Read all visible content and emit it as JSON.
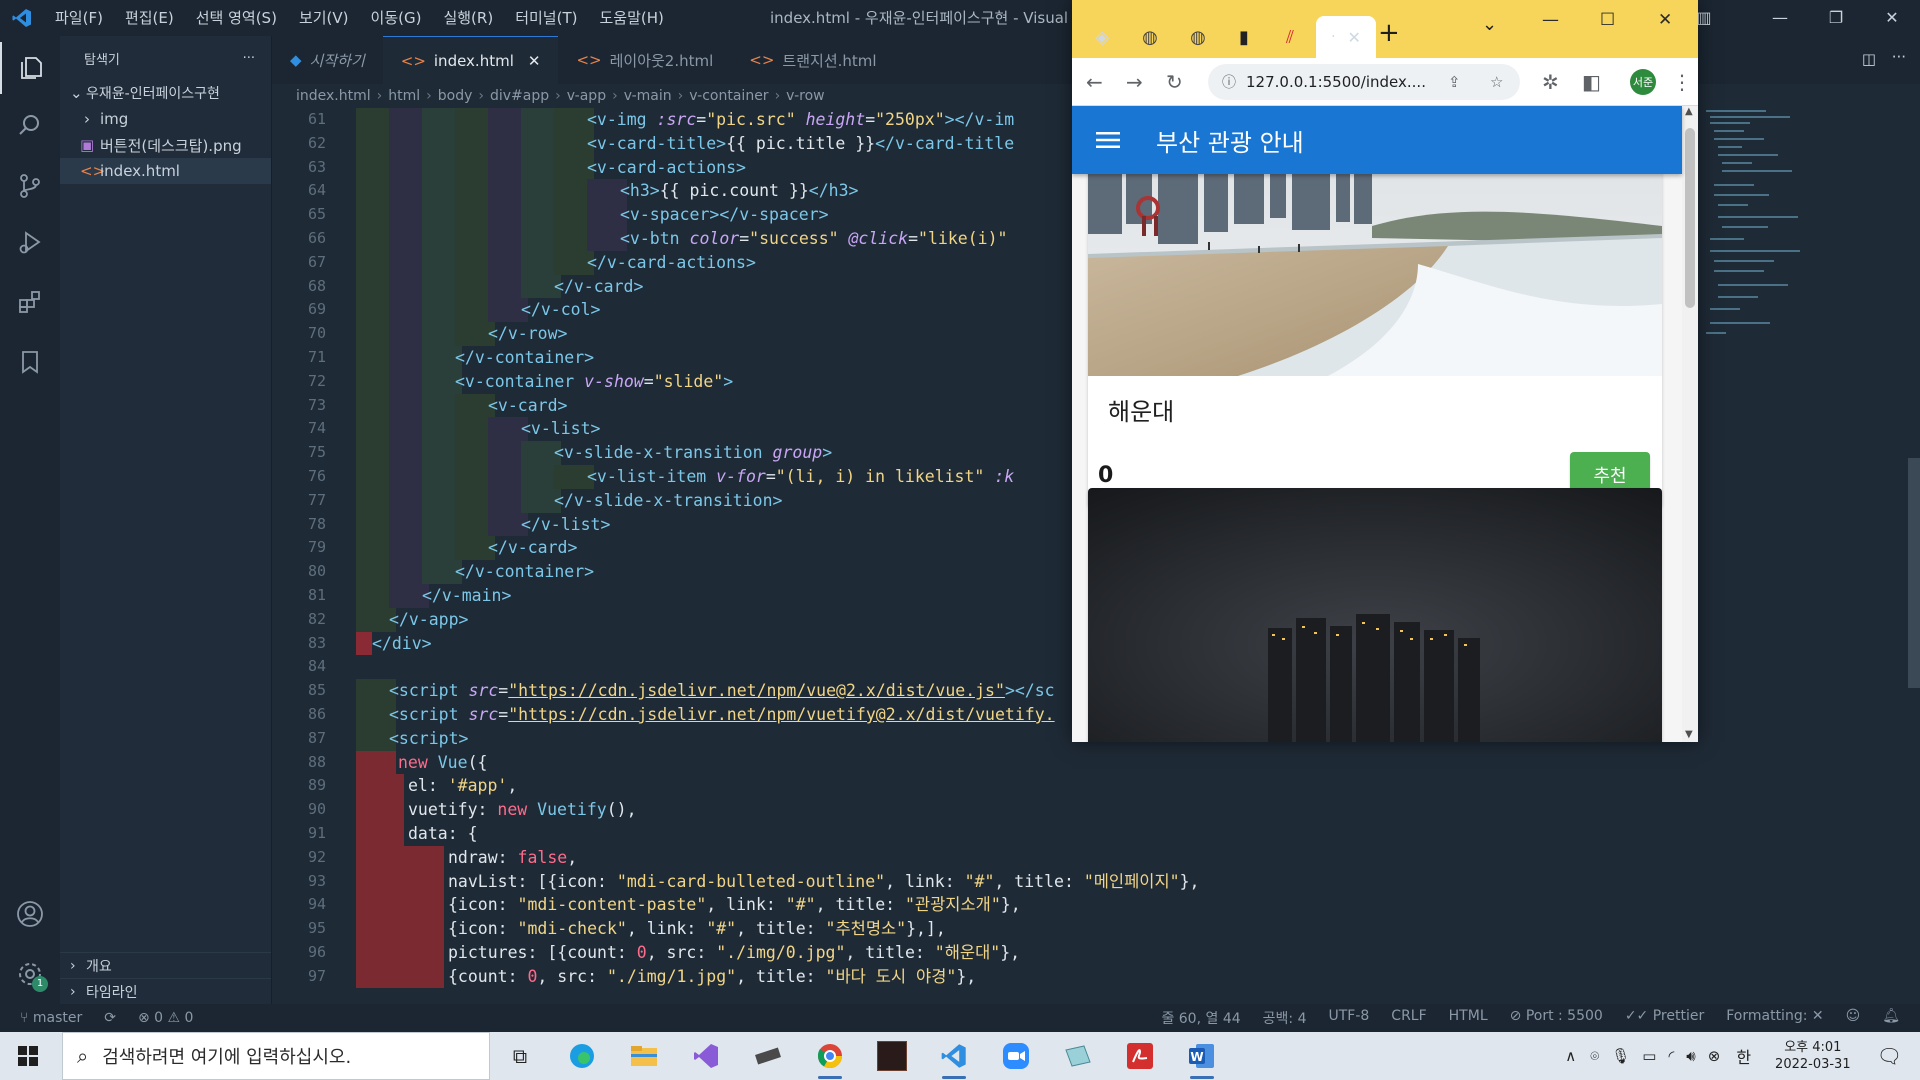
{
  "vscode": {
    "menu": [
      "파일(F)",
      "편집(E)",
      "선택 영역(S)",
      "보기(V)",
      "이동(G)",
      "실행(R)",
      "터미널(T)",
      "도움말(H)"
    ],
    "window_title": "index.html - 우재윤-인터페이스구현 - Visual S",
    "sidebar": {
      "title": "탐색기",
      "more": "···",
      "folder": "우재윤-인터페이스구현",
      "items": [
        {
          "label": "img",
          "kind": "folder"
        },
        {
          "label": "버튼전(데스크탑).png",
          "kind": "image"
        },
        {
          "label": "index.html",
          "kind": "html"
        }
      ],
      "bottom": [
        "개요",
        "타임라인"
      ]
    },
    "tabs": [
      {
        "label": "시작하기"
      },
      {
        "label": "index.html"
      },
      {
        "label": "레이아웃2.html"
      },
      {
        "label": "트랜지션.html"
      }
    ],
    "breadcrumb": [
      "index.html",
      "html",
      "body",
      "div#app",
      "v-app",
      "v-main",
      "v-container",
      "v-row"
    ],
    "line_numbers": [
      "61",
      "62",
      "63",
      "64",
      "65",
      "66",
      "67",
      "68",
      "69",
      "70",
      "71",
      "72",
      "73",
      "74",
      "75",
      "76",
      "77",
      "78",
      "79",
      "80",
      "81",
      "82",
      "83",
      "84",
      "85",
      "86",
      "87",
      "88",
      "89",
      "90",
      "91",
      "92",
      "93",
      "94",
      "95",
      "96",
      "97"
    ],
    "code": {
      "l61a": "<v-img ",
      "l61b": ":src",
      "l61c": "=",
      "l61d": "\"pic.src\"",
      "l61e": " height",
      "l61f": "\"250px\"",
      "l61g": "></v-im",
      "l62a": "<v-card-title>",
      "l62b": "{{ pic.title }}",
      "l62c": "</v-card-title",
      "l63": "<v-card-actions>",
      "l64a": "<h3>",
      "l64b": "{{ pic.count }}",
      "l64c": "</h3>",
      "l65": "<v-spacer></v-spacer>",
      "l66a": "<v-btn ",
      "l66b": "color",
      "l66c": "\"success\"",
      "l66d": " @click",
      "l66e": "\"like(i)\"",
      "l67": "</v-card-actions>",
      "l68": "</v-card>",
      "l69": "</v-col>",
      "l70": "</v-row>",
      "l71": "</v-container>",
      "l72a": "<v-container ",
      "l72b": "v-show",
      "l72c": "\"slide\"",
      "l72d": ">",
      "l73": "<v-card>",
      "l74": "<v-list>",
      "l75a": "<v-slide-x-transition ",
      "l75b": "group",
      "l75c": ">",
      "l76a": "<v-list-item ",
      "l76b": "v-for",
      "l76c": "\"(li, i) in likelist\"",
      "l76d": " :k",
      "l77": "</v-slide-x-transition>",
      "l78": "</v-list>",
      "l79": "</v-card>",
      "l80": "</v-container>",
      "l81": "</v-main>",
      "l82": "</v-app>",
      "l83": "</div>",
      "l85a": "<script ",
      "l85b": "src",
      "l85c": "\"https://cdn.jsdelivr.net/npm/vue@2.x/dist/vue.js\"",
      "l85d": "></sc",
      "l86a": "<script ",
      "l86b": "src",
      "l86c": "\"https://cdn.jsdelivr.net/npm/vuetify@2.x/dist/vuetify.",
      "l87": "<script>",
      "l88a": "new ",
      "l88b": "Vue",
      "l88c": "({",
      "l89a": "el: ",
      "l89b": "'#app'",
      "l89c": ",",
      "l90a": "vuetify: ",
      "l90b": "new ",
      "l90c": "Vuetify",
      "l90d": "(),",
      "l91a": "data: {",
      "l92a": "ndraw: ",
      "l92b": "false",
      "l92c": ",",
      "l93a": "navList: [{icon: ",
      "l93b": "\"mdi-card-bulleted-outline\"",
      "l93c": ", link: ",
      "l93d": "\"#\"",
      "l93e": ", title: ",
      "l93f": "\"메인페이지\"",
      "l93g": "},",
      "l94a": "{icon: ",
      "l94b": "\"mdi-content-paste\"",
      "l94c": ", link: ",
      "l94d": "\"#\"",
      "l94e": ", title: ",
      "l94f": "\"관광지소개\"",
      "l94g": "},",
      "l95a": "{icon: ",
      "l95b": "\"mdi-check\"",
      "l95c": ", link: ",
      "l95d": "\"#\"",
      "l95e": ", title: ",
      "l95f": "\"추천명소\"",
      "l95g": "},],",
      "l96a": "pictures: [{count: ",
      "l96b": "0",
      "l96c": ", src: ",
      "l96d": "\"./img/0.jpg\"",
      "l96e": ", title: ",
      "l96f": "\"해운대\"",
      "l96g": "},",
      "l97a": "{count: ",
      "l97b": "0",
      "l97c": ", src: ",
      "l97d": "\"./img/1.jpg\"",
      "l97e": ", title: ",
      "l97f": "\"바다 도시 야경\"",
      "l97g": "},"
    },
    "statusbar": {
      "branch": "master",
      "problems": "⊗ 0 ⚠ 0",
      "position": "줄 60, 열 44",
      "spaces": "공백: 4",
      "encoding": "UTF-8",
      "eol": "CRLF",
      "language": "HTML",
      "port": "Port : 5500",
      "prettier": "Prettier",
      "formatting": "Formatting: ✕"
    },
    "settings_badge": "1"
  },
  "browser": {
    "address": "127.0.0.1:5500/index....",
    "active_tab": "·",
    "profile": "서준",
    "page": {
      "app_title": "부산 관광 안내",
      "cards": [
        {
          "title": "해운대",
          "count": "0",
          "button": "추천"
        }
      ]
    }
  },
  "taskbar": {
    "search_placeholder": "검색하려면 여기에 입력하십시오.",
    "time": "오후 4:01",
    "date": "2022-03-31",
    "ime": "한"
  },
  "colors": {
    "vscode_bg": "#1e2a36",
    "chrome_tabstrip": "#f7d45a",
    "app_bar": "#1976d2",
    "success_button": "#4caf50"
  }
}
